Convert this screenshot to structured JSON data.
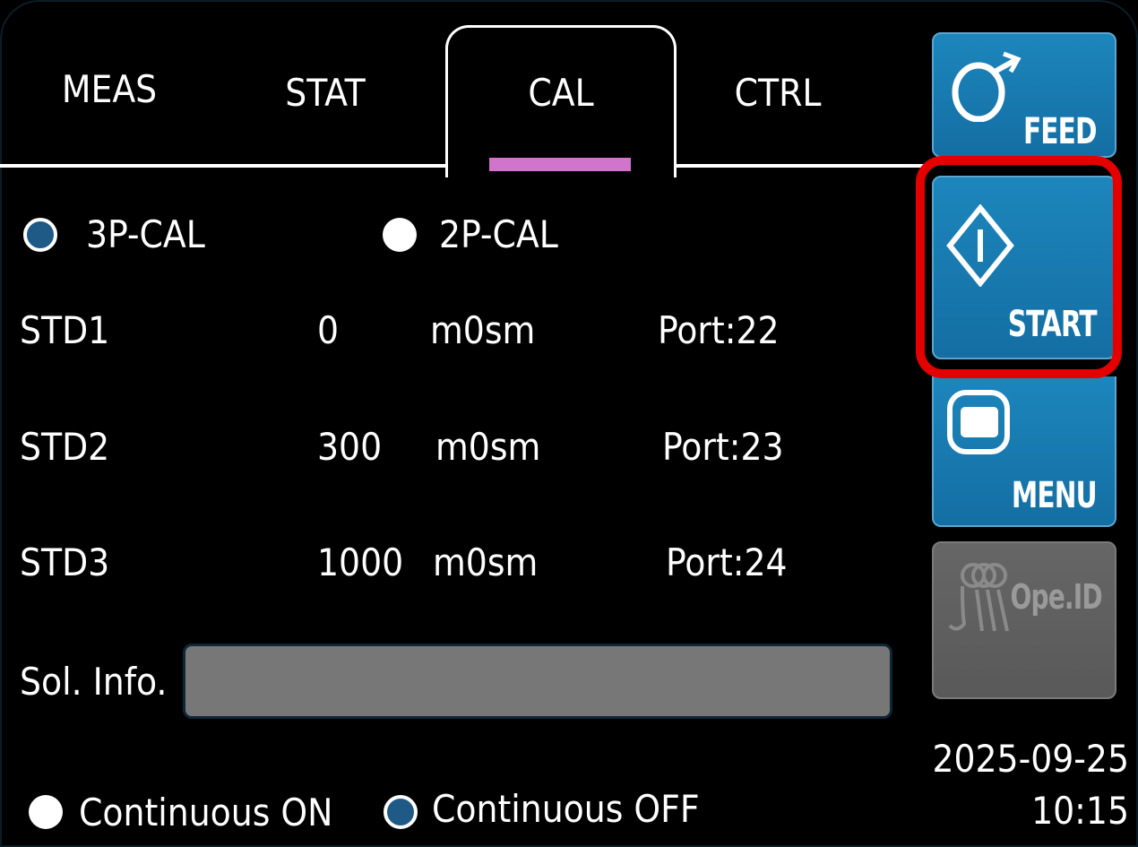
{
  "tabs": [
    {
      "label": "MEAS"
    },
    {
      "label": "STAT"
    },
    {
      "label": "CAL"
    },
    {
      "label": "CTRL"
    }
  ],
  "calibration_mode": {
    "options": [
      {
        "label": "3P-CAL",
        "selected": true
      },
      {
        "label": "2P-CAL",
        "selected": false
      }
    ]
  },
  "standards": [
    {
      "name": "STD1",
      "value": "0",
      "unit": "m0sm",
      "port": "Port:22"
    },
    {
      "name": "STD2",
      "value": "300",
      "unit": "m0sm",
      "port": "Port:23"
    },
    {
      "name": "STD3",
      "value": "1000",
      "unit": "m0sm",
      "port": "Port:24"
    }
  ],
  "solution_info": {
    "label": "Sol. Info.",
    "value": ""
  },
  "continuous": {
    "options": [
      {
        "label": "Continuous ON",
        "selected": false
      },
      {
        "label": "Continuous OFF",
        "selected": true
      }
    ]
  },
  "side_buttons": {
    "feed": {
      "label": "FEED",
      "icon": "feed-icon"
    },
    "start": {
      "label": "START",
      "icon": "start-icon"
    },
    "menu": {
      "label": "MENU",
      "icon": "menu-icon"
    },
    "operator_id": {
      "label": "Ope.ID",
      "icon": "operator-id-icon",
      "enabled": false
    }
  },
  "datetime": {
    "date": "2025-09-25",
    "time": "10:15"
  },
  "colors": {
    "accent": "#1c86bc",
    "tab_indicator": "#d175cc",
    "highlight": "#e50000",
    "disabled": "#666666"
  }
}
